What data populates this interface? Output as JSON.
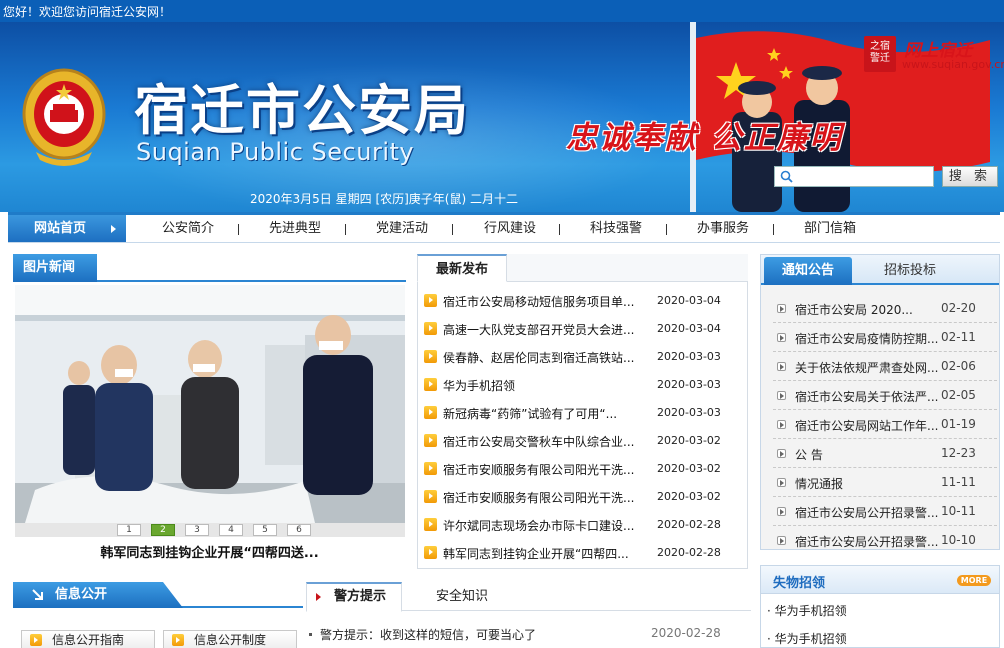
{
  "topbar": {
    "welcome": "您好！欢迎您访问宿迁公安网！"
  },
  "header": {
    "title_cn": "宿迁市公安局",
    "title_en": "Suqian Public Security",
    "date": "2020年3月5日 星期四 [农历]庚子年(鼠) 二月十二",
    "slogan": "忠诚奉献 公正廉明",
    "brand_seal": "之宿\n警迁",
    "brand_cn": "网上宿迁",
    "brand_url": "www.suqian.gov.cn",
    "search_placeholder": "",
    "search_button": "搜 索"
  },
  "nav": {
    "home": "网站首页",
    "items": [
      "公安简介",
      "先进典型",
      "党建活动",
      "行风建设",
      "科技强警",
      "办事服务",
      "部门信箱"
    ]
  },
  "photo_news": {
    "title": "图片新闻",
    "pages": [
      "1",
      "2",
      "3",
      "4",
      "5",
      "6"
    ],
    "active_page": "2",
    "caption": "韩军同志到挂钩企业开展“四帮四送..."
  },
  "latest": {
    "tab": "最新发布",
    "items": [
      {
        "title": "宿迁市公安局移动短信服务项目单...",
        "date": "2020-03-04"
      },
      {
        "title": "高速一大队党支部召开党员大会进...",
        "date": "2020-03-04"
      },
      {
        "title": "侯春静、赵居伦同志到宿迁高铁站...",
        "date": "2020-03-03"
      },
      {
        "title": "华为手机招领",
        "date": "2020-03-03"
      },
      {
        "title": "新冠病毒“药筛”试验有了可用“...",
        "date": "2020-03-03"
      },
      {
        "title": "宿迁市公安局交警秋车中队综合业...",
        "date": "2020-03-02"
      },
      {
        "title": "宿迁市安顺服务有限公司阳光干洗...",
        "date": "2020-03-02"
      },
      {
        "title": "宿迁市安顺服务有限公司阳光干洗...",
        "date": "2020-03-02"
      },
      {
        "title": "许尔斌同志现场会办市际卡口建设...",
        "date": "2020-02-28"
      },
      {
        "title": "韩军同志到挂钩企业开展“四帮四...",
        "date": "2020-02-28"
      }
    ]
  },
  "notice": {
    "tab_active": "通知公告",
    "tab_inactive": "招标投标",
    "items": [
      {
        "title": "宿迁市公安局 2020...",
        "date": "02-20"
      },
      {
        "title": "宿迁市公安局疫情防控期...",
        "date": "02-11"
      },
      {
        "title": "关于依法依规严肃查处网...",
        "date": "02-06"
      },
      {
        "title": "宿迁市公安局关于依法严...",
        "date": "02-05"
      },
      {
        "title": "宿迁市公安局网站工作年...",
        "date": "01-19"
      },
      {
        "title": "公 告",
        "date": "12-23"
      },
      {
        "title": "情况通报",
        "date": "11-11"
      },
      {
        "title": "宿迁市公安局公开招录警...",
        "date": "10-11"
      },
      {
        "title": "宿迁市公安局公开招录警...",
        "date": "10-10"
      }
    ]
  },
  "lost_found": {
    "title": "失物招领",
    "more": "MORE",
    "items": [
      "· 华为手机招领",
      "· 华为手机招领"
    ]
  },
  "info_public": {
    "title": "信息公开",
    "buttons": [
      "信息公开指南",
      "信息公开制度"
    ]
  },
  "alerts": {
    "tab_active": "警方提示",
    "tab_inactive": "安全知识",
    "items": [
      {
        "title": "警方提示：收到这样的短信，可要当心了",
        "date": "2020-02-28"
      }
    ]
  },
  "colors": {
    "primary": "#1f7bc8",
    "banner_top": "#0d4fa4",
    "accent_red": "#d8141a",
    "bullet_orange": "#f29a07"
  }
}
